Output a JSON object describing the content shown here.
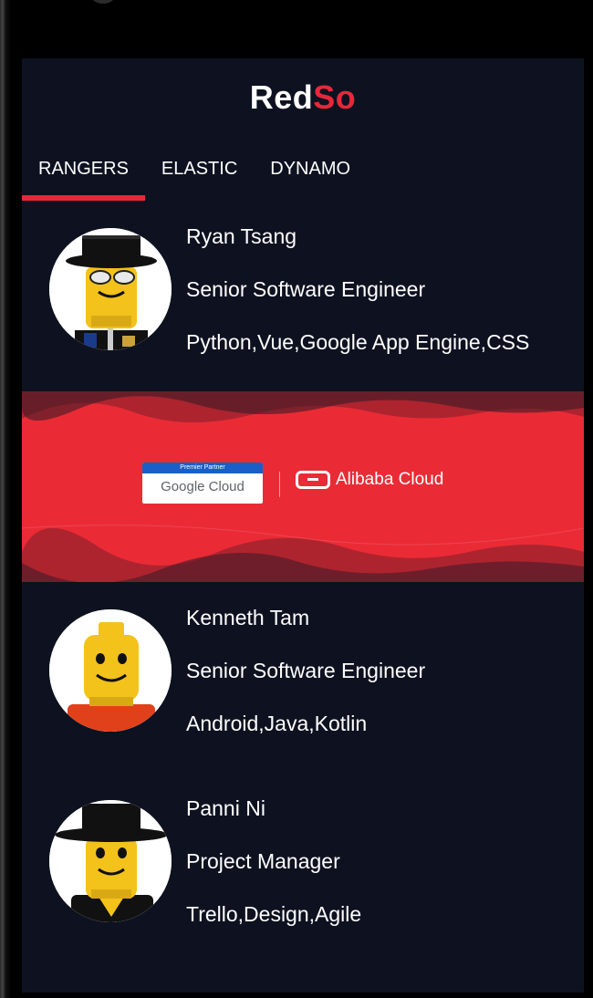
{
  "app": {
    "title_white": "Red",
    "title_red": "So",
    "colors": {
      "accent": "#e6283a",
      "background": "#0e1220"
    }
  },
  "tabs": [
    {
      "label": "RANGERS",
      "active": true
    },
    {
      "label": "ELASTIC",
      "active": false
    },
    {
      "label": "DYNAMO",
      "active": false
    }
  ],
  "members": [
    {
      "name": "Ryan Tsang",
      "role": "Senior Software Engineer",
      "skills": "Python,Vue,Google App Engine,CSS",
      "avatar": "lego-glasses-hat"
    },
    {
      "name": "Kenneth Tam",
      "role": "Senior Software Engineer",
      "skills": "Android,Java,Kotlin",
      "avatar": "lego-plain"
    },
    {
      "name": "Panni Ni",
      "role": "Project Manager",
      "skills": "Trello,Design,Agile",
      "avatar": "lego-hat"
    }
  ],
  "banner": {
    "premier_label": "Premier Partner",
    "google_label": "Google Cloud",
    "alibaba_label": "Alibaba Cloud"
  }
}
